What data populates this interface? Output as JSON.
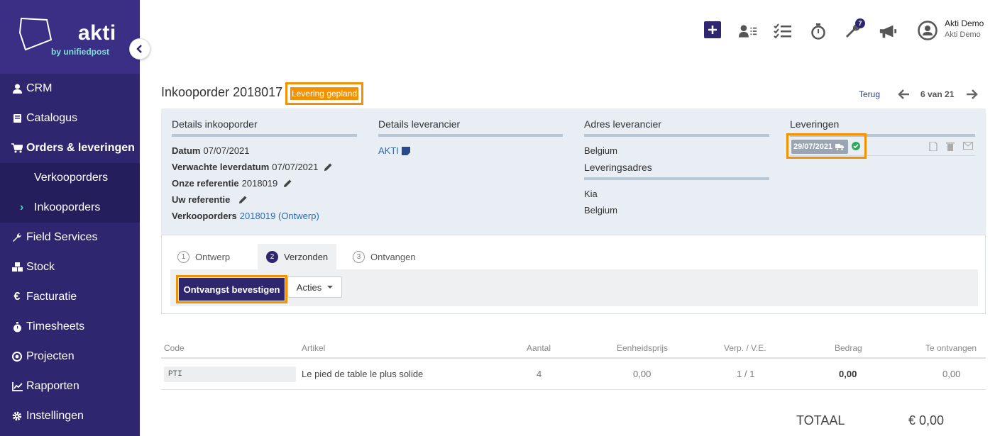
{
  "brand": {
    "name": "akti",
    "sub": "by unifiedpost"
  },
  "sidebar": {
    "items": [
      {
        "label": "CRM",
        "icon": "user-icon"
      },
      {
        "label": "Catalogus",
        "icon": "book-icon"
      },
      {
        "label": "Orders & leveringen",
        "icon": "cart-icon"
      },
      {
        "label": "Field Services",
        "icon": "wrench-icon"
      },
      {
        "label": "Stock",
        "icon": "cubes-icon"
      },
      {
        "label": "Facturatie",
        "icon": "euro-icon"
      },
      {
        "label": "Timesheets",
        "icon": "stopwatch-icon"
      },
      {
        "label": "Projecten",
        "icon": "target-icon"
      },
      {
        "label": "Rapporten",
        "icon": "chart-icon"
      },
      {
        "label": "Instellingen",
        "icon": "gear-icon"
      }
    ],
    "sub": [
      {
        "label": "Verkooporders"
      },
      {
        "label": "Inkooporders"
      }
    ]
  },
  "header": {
    "badge_count": "7",
    "user_name": "Akti Demo",
    "user_company": "Akti Demo"
  },
  "page": {
    "title": "Inkooporder 2018017",
    "status": "Levering gepland",
    "back": "Terug",
    "pager": "6 van 21"
  },
  "details": {
    "order": {
      "heading": "Details inkooporder",
      "fields": [
        {
          "label": "Datum",
          "value": "07/07/2021"
        },
        {
          "label": "Verwachte leverdatum",
          "value": "07/07/2021"
        },
        {
          "label": "Onze referentie",
          "value": "2018019"
        },
        {
          "label": "Uw referentie",
          "value": ""
        },
        {
          "label": "Verkooporders",
          "value": "2018019 (Ontwerp)"
        }
      ]
    },
    "supplier": {
      "heading": "Details leverancier",
      "name": "AKTI"
    },
    "supplier_address": {
      "heading": "Adres leverancier",
      "country": "Belgium"
    },
    "delivery_address": {
      "heading": "Leveringsadres",
      "line1": "Kia",
      "country": "Belgium"
    },
    "deliveries": {
      "heading": "Leveringen",
      "date": "29/07/2021"
    }
  },
  "workflow": {
    "steps": [
      {
        "num": "1",
        "label": "Ontwerp"
      },
      {
        "num": "2",
        "label": "Verzonden"
      },
      {
        "num": "3",
        "label": "Ontvangen"
      }
    ],
    "primary": "Ontvangst bevestigen",
    "actions": "Acties"
  },
  "table": {
    "headers": [
      "Code",
      "Artikel",
      "Aantal",
      "Eenheidsprijs",
      "Verp. / V.E.",
      "Bedrag",
      "Te ontvangen"
    ],
    "rows": [
      {
        "code": "PTI",
        "article": "Le pied de table le plus solide",
        "qty": "4",
        "unit_price": "0,00",
        "pack": "1 / 1",
        "amount": "0,00",
        "to_receive": "0,00"
      }
    ]
  },
  "totals": {
    "label": "TOTAAL",
    "value": "€ 0,00"
  },
  "colors": {
    "primary": "#2e2770",
    "accent": "#f39200",
    "teal": "#4fd1c5"
  }
}
